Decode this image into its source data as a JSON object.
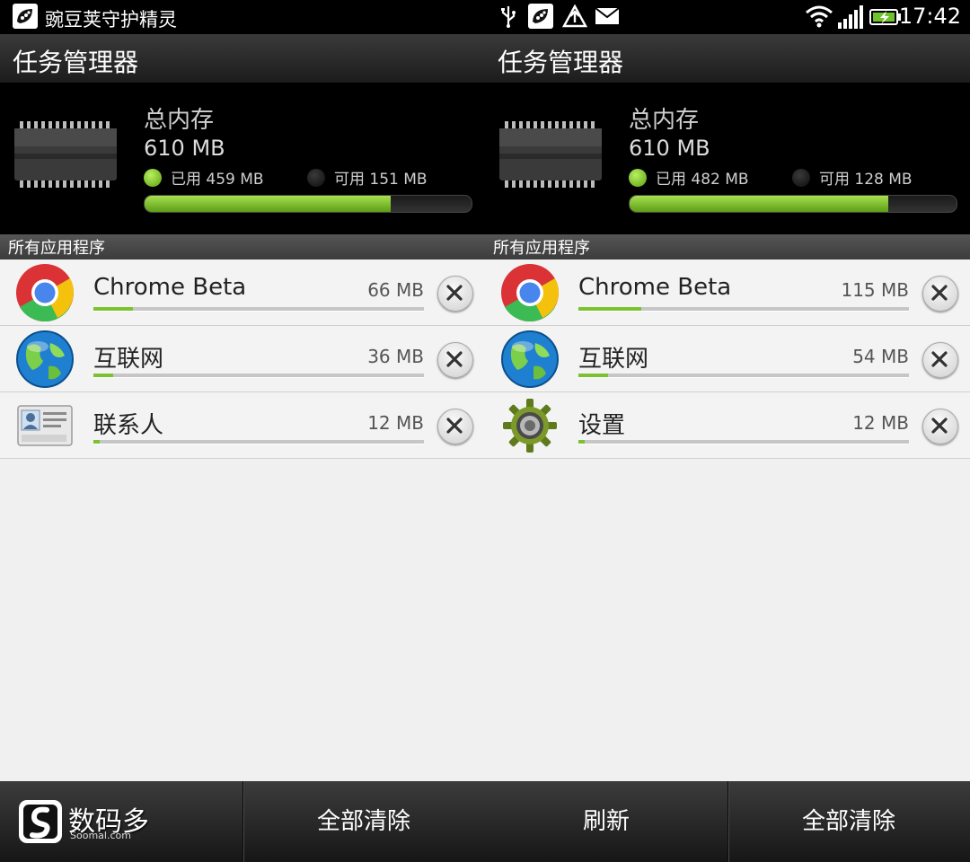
{
  "status_bar": {
    "notification_text": "豌豆荚守护精灵",
    "time": "17:42"
  },
  "panels": [
    {
      "title": "任务管理器",
      "memory": {
        "label": "总内存",
        "total": "610 MB",
        "used": "已用 459 MB",
        "free": "可用 151 MB",
        "used_fraction": 0.753
      },
      "section_label": "所有应用程序",
      "apps": [
        {
          "name": "Chrome Beta",
          "size": "66 MB",
          "icon": "chrome-icon",
          "usage_fraction": 0.12
        },
        {
          "name": "互联网",
          "size": "36 MB",
          "icon": "globe-icon",
          "usage_fraction": 0.06
        },
        {
          "name": "联系人",
          "size": "12 MB",
          "icon": "contacts-icon",
          "usage_fraction": 0.02
        }
      ],
      "buttons": {
        "left": "",
        "right": "全部清除"
      }
    },
    {
      "title": "任务管理器",
      "memory": {
        "label": "总内存",
        "total": "610 MB",
        "used": "已用 482 MB",
        "free": "可用 128 MB",
        "used_fraction": 0.79
      },
      "section_label": "所有应用程序",
      "apps": [
        {
          "name": "Chrome Beta",
          "size": "115 MB",
          "icon": "chrome-icon",
          "usage_fraction": 0.19
        },
        {
          "name": "互联网",
          "size": "54 MB",
          "icon": "globe-icon",
          "usage_fraction": 0.09
        },
        {
          "name": "设置",
          "size": "12 MB",
          "icon": "gear-icon",
          "usage_fraction": 0.02
        }
      ],
      "buttons": {
        "left": "刷新",
        "right": "全部清除"
      }
    }
  ],
  "watermark": {
    "text": "数码多",
    "sub": "Soomal.com"
  },
  "colors": {
    "accent_green": "#7cc230",
    "background": "#f0f0f0"
  }
}
